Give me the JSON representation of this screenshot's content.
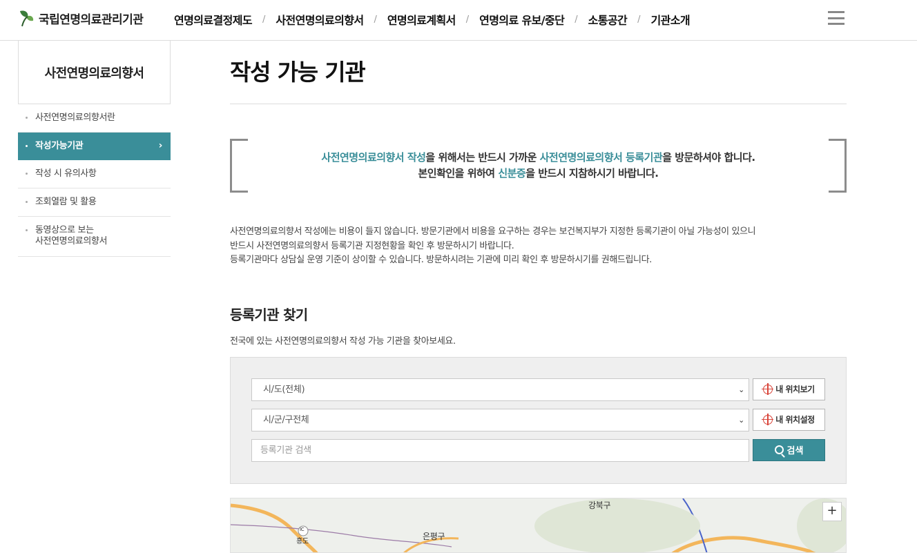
{
  "header": {
    "logo_text": "국립연명의료관리기관",
    "nav": [
      "연명의료결정제도",
      "사전연명의료의향서",
      "연명의료계획서",
      "연명의료 유보/중단",
      "소통공간",
      "기관소개"
    ],
    "separator": "/"
  },
  "sidebar": {
    "title": "사전연명의료의향서",
    "items": [
      {
        "label": "사전연명의료의향서란"
      },
      {
        "label": "작성가능기관",
        "active": true
      },
      {
        "label": "작성 시 유의사항"
      },
      {
        "label": "조회열람 및 활용"
      },
      {
        "label_line1": "동영상으로 보는",
        "label_line2": "사전연명의료의향서"
      }
    ],
    "active_chevron": "›"
  },
  "main": {
    "title": "작성 가능 기관",
    "notice": {
      "line1": [
        "사전연명의료의향서 작성",
        "을 위해서는 반드시 가까운 ",
        "사전연명의료의향서 등록기관",
        "을 방문하셔야 합니다."
      ],
      "line2": [
        "본인확인을 위하여 ",
        "신분증",
        "을 반드시 지참하시기 바랍니다."
      ]
    },
    "description": [
      "사전연명의료의향서 작성에는 비용이 들지 않습니다. 방문기관에서 비용을 요구하는 경우는 보건복지부가 지정한 등록기관이 아닐 가능성이 있으니",
      "반드시 사전연명의료의향서 등록기관 지정현황을 확인 후 방문하시기 바랍니다.",
      "등록기관마다 상담실 운영 기준이 상이할 수 있습니다. 방문하시려는 기관에 미리 확인 후 방문하시기를 권해드립니다."
    ],
    "section_title": "등록기관 찾기",
    "section_sub": "전국에 있는 사전연명의료의향서 작성 가능 기관을 찾아보세요.",
    "search": {
      "sido_value": "시/도(전체)",
      "sigungu_value": "시/군/구전체",
      "keyword_placeholder": "등록기관 검색",
      "my_location_view": "내 위치보기",
      "my_location_set": "내 위치설정",
      "search_button": "검색"
    },
    "map": {
      "labels": [
        "강북구",
        "은평구",
        "IC",
        "흥도"
      ],
      "zoom_in": "+"
    }
  },
  "colors": {
    "accent": "#3a8e99",
    "target_icon": "#d9453a"
  }
}
